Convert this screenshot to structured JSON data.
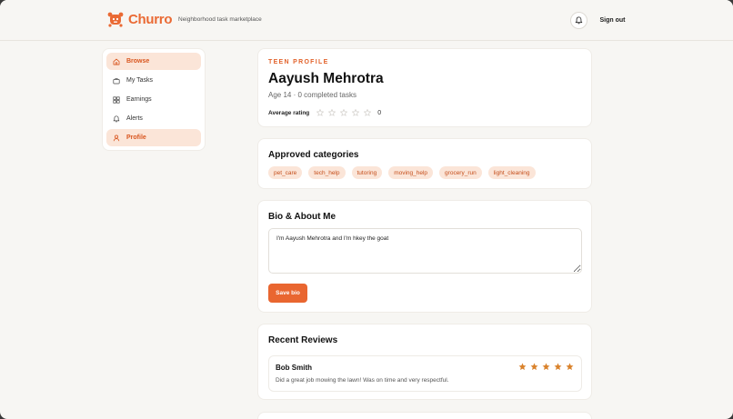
{
  "app": {
    "name": "Churro",
    "tagline": "Neighborhood task marketplace",
    "accent": "#e96630",
    "sign_out_label": "Sign out"
  },
  "sidebar": {
    "items": [
      {
        "label": "Browse",
        "icon": "home-icon"
      },
      {
        "label": "My Tasks",
        "icon": "briefcase-icon"
      },
      {
        "label": "Earnings",
        "icon": "grid-icon"
      },
      {
        "label": "Alerts",
        "icon": "bell-icon"
      },
      {
        "label": "Profile",
        "icon": "user-icon"
      }
    ]
  },
  "profile": {
    "eyebrow": "TEEN PROFILE",
    "name": "Aayush Mehrotra",
    "subtitle": "Age 14 · 0 completed tasks",
    "rating_label": "Average rating",
    "rating_value": "0",
    "rating_stars": 0
  },
  "categories": {
    "title": "Approved categories",
    "items": [
      "pet_care",
      "tech_help",
      "tutoring",
      "moving_help",
      "grocery_run",
      "light_cleaning"
    ]
  },
  "bio": {
    "title": "Bio & About Me",
    "value": "I'm Aayush Mehrotra and I'm hkey the goat",
    "save_label": "Save bio"
  },
  "reviews": {
    "title": "Recent Reviews",
    "items": [
      {
        "reviewer": "Bob Smith",
        "text": "Did a great job mowing the lawn! Was on time and very respectful.",
        "stars": 5
      }
    ]
  }
}
